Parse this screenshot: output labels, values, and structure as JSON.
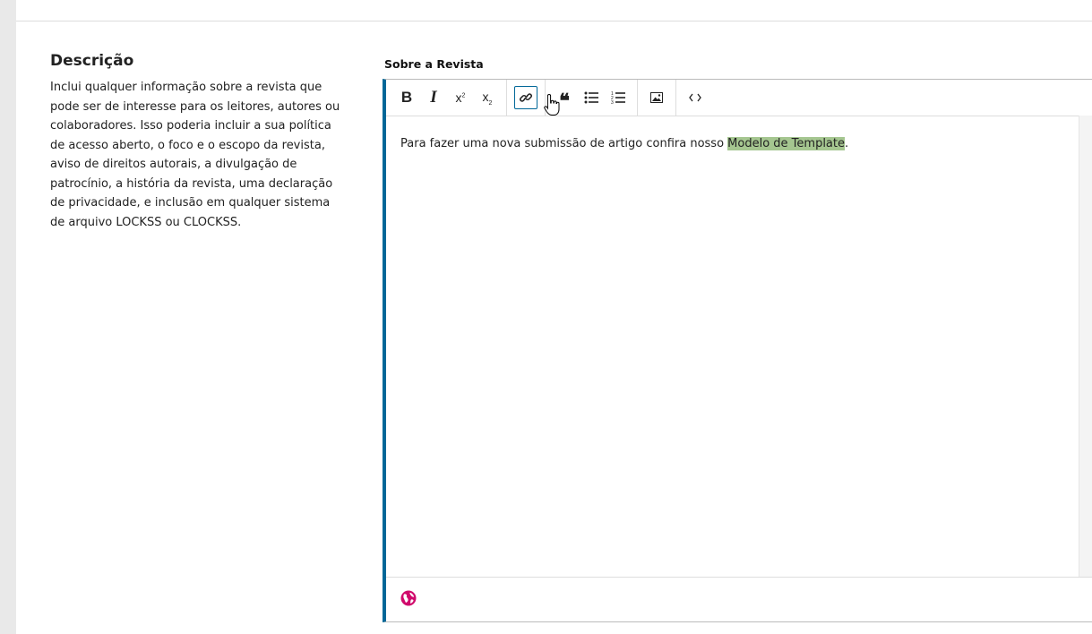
{
  "description": {
    "title": "Descrição",
    "text": "Inclui qualquer informação sobre a revista que pode ser de interesse para os leitores, autores ou colaboradores. Isso poderia incluir a sua política de acesso aberto, o foco e o escopo da revista, aviso de direitos autorais, a divulgação de patrocínio, a história da revista, uma declaração de privacidade, e inclusão em qualquer sistema de arquivo LOCKSS ou CLOCKSS."
  },
  "editor": {
    "label": "Sobre a Revista",
    "content_before": "Para fazer uma nova submissão de artigo confira nosso ",
    "content_highlight": "Modelo de Template",
    "content_after": ".",
    "toolbar": {
      "bold": "B",
      "italic": "I",
      "superscript": "x",
      "superscript_mark": "2",
      "subscript": "x",
      "subscript_mark": "2",
      "blockquote": "❝",
      "active_tool": "link"
    },
    "footer_icon": "globe-icon"
  },
  "colors": {
    "accent": "#006798",
    "highlight": "#a5c690",
    "globe": "#d00a6c"
  }
}
